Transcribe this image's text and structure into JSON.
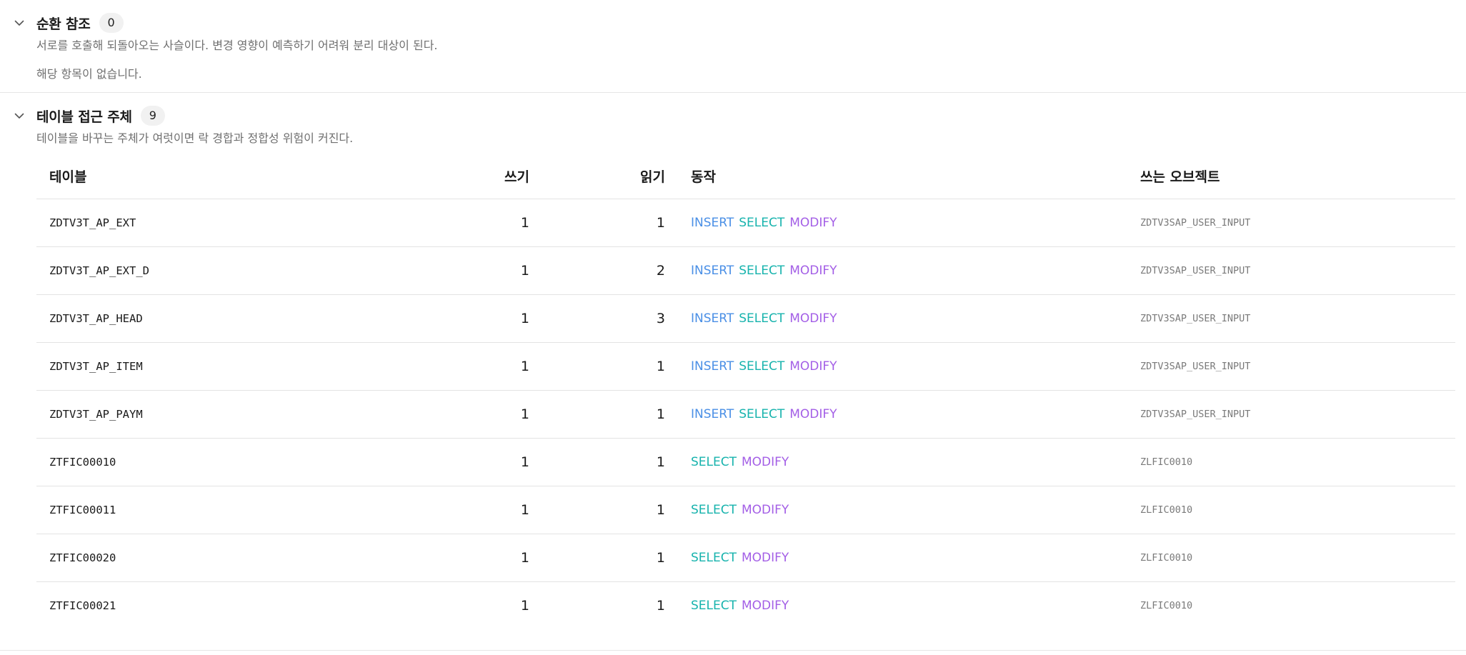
{
  "sections": [
    {
      "title": "순환 참조",
      "count": "0",
      "description": "서로를 호출해 되돌아오는 사슬이다. 변경 영향이 예측하기 어려워 분리 대상이 된다.",
      "empty_text": "해당 항목이 없습니다."
    },
    {
      "title": "테이블 접근 주체",
      "count": "9",
      "description": "테이블을 바꾸는 주체가 여럿이면 락 경합과 정합성 위험이 커진다."
    }
  ],
  "table": {
    "headers": {
      "table": "테이블",
      "write": "쓰기",
      "read": "읽기",
      "actions": "동작",
      "writers": "쓰는 오브젝트"
    },
    "rows": [
      {
        "table": "ZDTV3T_AP_EXT",
        "write": "1",
        "read": "1",
        "actions": [
          "INSERT",
          "SELECT",
          "MODIFY"
        ],
        "writers": "ZDTV3SAP_USER_INPUT"
      },
      {
        "table": "ZDTV3T_AP_EXT_D",
        "write": "1",
        "read": "2",
        "actions": [
          "INSERT",
          "SELECT",
          "MODIFY"
        ],
        "writers": "ZDTV3SAP_USER_INPUT"
      },
      {
        "table": "ZDTV3T_AP_HEAD",
        "write": "1",
        "read": "3",
        "actions": [
          "INSERT",
          "SELECT",
          "MODIFY"
        ],
        "writers": "ZDTV3SAP_USER_INPUT"
      },
      {
        "table": "ZDTV3T_AP_ITEM",
        "write": "1",
        "read": "1",
        "actions": [
          "INSERT",
          "SELECT",
          "MODIFY"
        ],
        "writers": "ZDTV3SAP_USER_INPUT"
      },
      {
        "table": "ZDTV3T_AP_PAYM",
        "write": "1",
        "read": "1",
        "actions": [
          "INSERT",
          "SELECT",
          "MODIFY"
        ],
        "writers": "ZDTV3SAP_USER_INPUT"
      },
      {
        "table": "ZTFIC00010",
        "write": "1",
        "read": "1",
        "actions": [
          "SELECT",
          "MODIFY"
        ],
        "writers": "ZLFIC0010"
      },
      {
        "table": "ZTFIC00011",
        "write": "1",
        "read": "1",
        "actions": [
          "SELECT",
          "MODIFY"
        ],
        "writers": "ZLFIC0010"
      },
      {
        "table": "ZTFIC00020",
        "write": "1",
        "read": "1",
        "actions": [
          "SELECT",
          "MODIFY"
        ],
        "writers": "ZLFIC0010"
      },
      {
        "table": "ZTFIC00021",
        "write": "1",
        "read": "1",
        "actions": [
          "SELECT",
          "MODIFY"
        ],
        "writers": "ZLFIC0010"
      }
    ]
  },
  "action_colors": {
    "INSERT": "#4a8fe6",
    "SELECT": "#17b3ad",
    "MODIFY": "#a35ee6"
  },
  "icons": {
    "collapse_toggle": "chevron-down-icon"
  }
}
